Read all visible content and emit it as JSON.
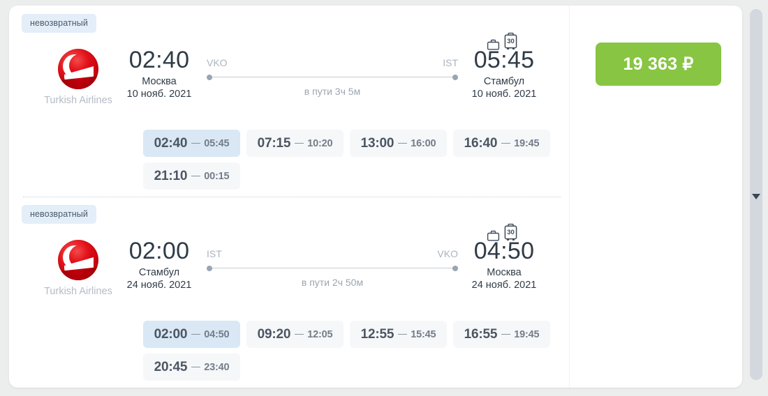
{
  "page": {
    "background_color": "#eceded"
  },
  "colors": {
    "price_button": "#87c543",
    "badge_bg": "#e3eef8",
    "slot_bg": "#f5f7f9",
    "slot_selected_bg": "#d9e8f4",
    "airline_red": "#e3121a"
  },
  "legs": [
    {
      "refund_badge": "невозвратный",
      "airline": {
        "name": "Turkish Airlines",
        "logo_icon": "turkish-airlines-logo-icon"
      },
      "departure": {
        "time": "02:40",
        "city": "Москва",
        "date": "10 нояб. 2021",
        "code": "VKO"
      },
      "arrival": {
        "time": "05:45",
        "city": "Стамбул",
        "date": "10 нояб. 2021",
        "code": "IST"
      },
      "duration": "в пути 3ч 5м",
      "baggage": {
        "carry_on_icon": "carry-on-bag-icon",
        "checked_icon": "checked-bag-icon",
        "checked_weight": "30"
      },
      "slots": [
        {
          "departure": "02:40",
          "arrival": "05:45",
          "selected": true
        },
        {
          "departure": "07:15",
          "arrival": "10:20",
          "selected": false
        },
        {
          "departure": "13:00",
          "arrival": "16:00",
          "selected": false
        },
        {
          "departure": "16:40",
          "arrival": "19:45",
          "selected": false
        },
        {
          "departure": "21:10",
          "arrival": "00:15",
          "selected": false
        }
      ]
    },
    {
      "refund_badge": "невозвратный",
      "airline": {
        "name": "Turkish Airlines",
        "logo_icon": "turkish-airlines-logo-icon"
      },
      "departure": {
        "time": "02:00",
        "city": "Стамбул",
        "date": "24 нояб. 2021",
        "code": "IST"
      },
      "arrival": {
        "time": "04:50",
        "city": "Москва",
        "date": "24 нояб. 2021",
        "code": "VKO"
      },
      "duration": "в пути 2ч 50м",
      "baggage": {
        "carry_on_icon": "carry-on-bag-icon",
        "checked_icon": "checked-bag-icon",
        "checked_weight": "30"
      },
      "slots": [
        {
          "departure": "02:00",
          "arrival": "04:50",
          "selected": true
        },
        {
          "departure": "09:20",
          "arrival": "12:05",
          "selected": false
        },
        {
          "departure": "12:55",
          "arrival": "15:45",
          "selected": false
        },
        {
          "departure": "16:55",
          "arrival": "19:45",
          "selected": false
        },
        {
          "departure": "20:45",
          "arrival": "23:40",
          "selected": false
        }
      ]
    }
  ],
  "price": {
    "label": "19 363 ₽",
    "amount": "19 363",
    "currency": "₽"
  },
  "scrollbar": {
    "down_arrow_icon": "chevron-down-icon"
  }
}
